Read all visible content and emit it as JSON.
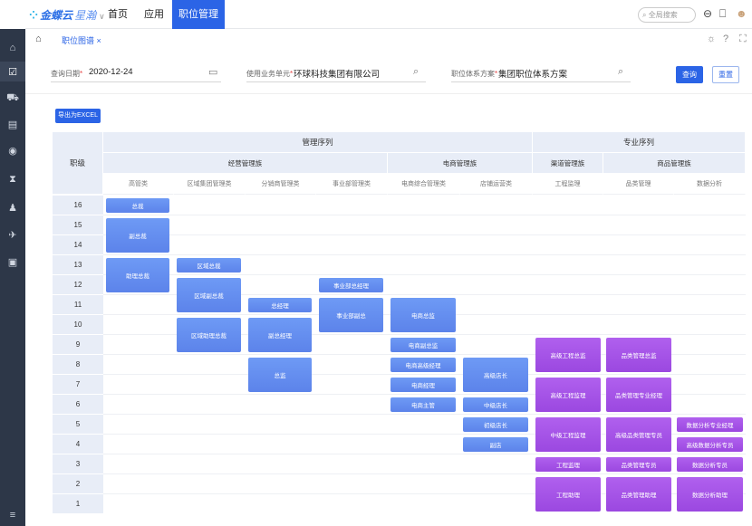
{
  "topbar": {
    "logo_main": "金蝶云",
    "logo_sub": "星瀚",
    "nav": [
      {
        "label": "首页"
      },
      {
        "label": "应用"
      },
      {
        "label": "职位管理"
      }
    ],
    "search_placeholder": "全局搜索"
  },
  "tab": {
    "label": "职位图谱 ×"
  },
  "filters": {
    "query_date": {
      "label": "查询日期",
      "value": "2020-12-24"
    },
    "business_unit": {
      "label": "使用业务单元",
      "value": "环球科技集团有限公司"
    },
    "position_scheme": {
      "label": "职位体系方案",
      "value": "集团职位体系方案"
    },
    "query_button": "查询",
    "reset_button": "重置",
    "required_mark": "*"
  },
  "export_button": "导出为EXCEL",
  "grid": {
    "level_header": "职级",
    "sequences": [
      "管理序列",
      "专业序列"
    ],
    "families": [
      "经营管理族",
      "电商管理族",
      "渠道管理族",
      "商品管理族"
    ],
    "categories": [
      "高管类",
      "区域集团管理类",
      "分销商管理类",
      "事业部管理类",
      "电商综合管理类",
      "店铺运营类",
      "工程监理",
      "品类管理",
      "数据分析"
    ],
    "levels": [
      "16",
      "15",
      "14",
      "13",
      "12",
      "11",
      "10",
      "9",
      "8",
      "7",
      "6",
      "5",
      "4",
      "3",
      "2",
      "1"
    ],
    "positions": {
      "p1": "总裁",
      "p2": "副总裁",
      "p3": "助理总裁",
      "p4": "区域总裁",
      "p5": "区域副总裁",
      "p6": "区域助理总裁",
      "p7": "总经理",
      "p8": "副总经理",
      "p9": "总监",
      "p10": "事业部总经理",
      "p11": "事业部副总",
      "p12": "电商总监",
      "p13": "电商副总监",
      "p14": "电商高级经理",
      "p15": "电商经理",
      "p16": "电商主管",
      "p17": "高级店长",
      "p18": "中级店长",
      "p19": "初级店长",
      "p20": "副店",
      "p21": "高级工程总监",
      "p22": "高级工程监理",
      "p23": "中级工程监理",
      "p24": "工程监理",
      "p25": "工程助理",
      "p26": "品类管理总监",
      "p27": "品类管理专业经理",
      "p28": "高级品类管理专员",
      "p29": "品类管理专员",
      "p30": "品类管理助理",
      "p31": "数据分析专业经理",
      "p32": "高级数据分析专员",
      "p33": "数据分析专员",
      "p34": "数据分析助理"
    }
  },
  "colors": {
    "primary": "#2b64e6",
    "cell_blue": "#6b93f0",
    "cell_purple": "#a855e8",
    "header_bg": "#e8edf7"
  }
}
